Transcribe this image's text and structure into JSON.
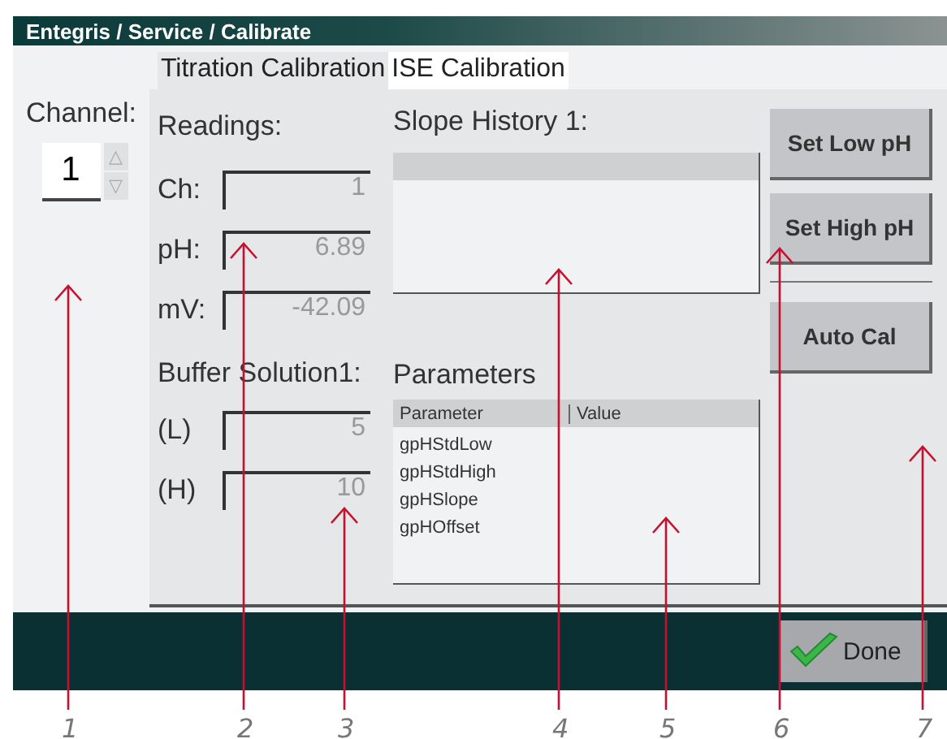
{
  "window": {
    "title": "Entegris / Service / Calibrate"
  },
  "channel": {
    "label": "Channel:",
    "value": "1",
    "up": "△",
    "down": "▽"
  },
  "tabs": [
    {
      "label": "Titration Calibration",
      "selected": true
    },
    {
      "label": "ISE Calibration",
      "selected": false
    }
  ],
  "readings": {
    "title": "Readings:",
    "rows": [
      {
        "label": "Ch:",
        "value": "1"
      },
      {
        "label": "pH:",
        "value": "6.89"
      },
      {
        "label": "mV:",
        "value": "-42.09"
      }
    ]
  },
  "buffer": {
    "title": "Buffer Solution1:",
    "rows": [
      {
        "label": "(L)",
        "value": "5"
      },
      {
        "label": "(H)",
        "value": "10"
      }
    ]
  },
  "slope_history": {
    "title": "Slope History 1:"
  },
  "parameters": {
    "title": "Parameters",
    "columns": [
      "Parameter",
      "Value"
    ],
    "rows": [
      {
        "parameter": "gpHStdLow"
      },
      {
        "parameter": "gpHStdHigh"
      },
      {
        "parameter": "gpHSlope"
      },
      {
        "parameter": "gpHOffset"
      }
    ]
  },
  "buttons": [
    "Set Low pH",
    "Set High pH",
    "Auto Cal"
  ],
  "done_button": {
    "label": "Done"
  },
  "annotations": [
    {
      "label": "1"
    },
    {
      "label": "2"
    },
    {
      "label": "3"
    },
    {
      "label": "4"
    },
    {
      "label": "5"
    },
    {
      "label": "6"
    },
    {
      "label": "7"
    }
  ]
}
